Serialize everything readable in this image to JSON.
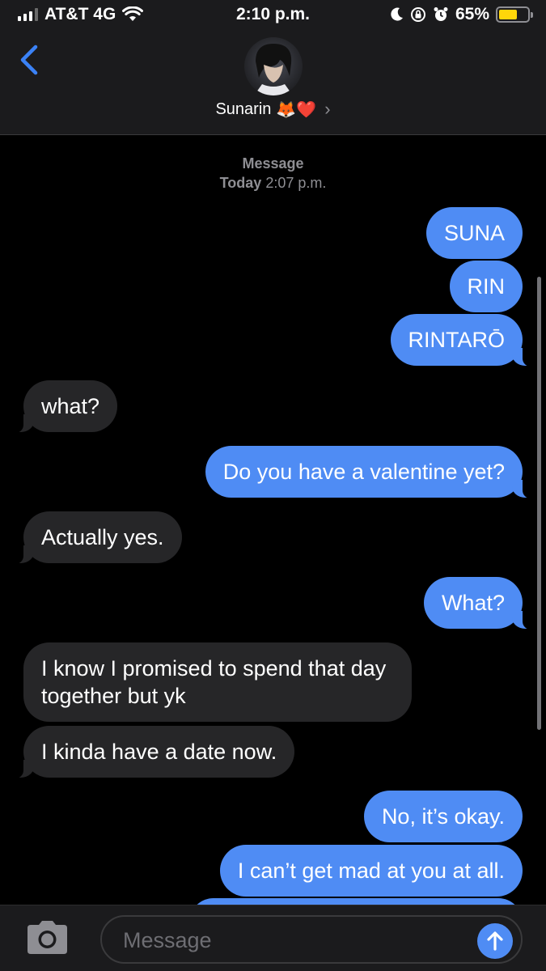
{
  "status_bar": {
    "carrier": "AT&T 4G",
    "time": "2:10 p.m.",
    "battery": "65%",
    "battery_level": 0.65,
    "icons": [
      "signal-icon",
      "wifi-icon",
      "moon-icon",
      "orientation-lock-icon",
      "alarm-icon",
      "battery-icon"
    ]
  },
  "header": {
    "contact_name": "Sunarin",
    "emoji": "🦊❤️",
    "chevron": "›"
  },
  "thread": {
    "service_label": "Message",
    "day_label": "Today",
    "time_label": "2:07 p.m.",
    "messages": [
      {
        "from": "me",
        "text": "SUNA"
      },
      {
        "from": "me",
        "text": "RIN"
      },
      {
        "from": "me",
        "text": "RINTARŌ"
      },
      {
        "from": "them",
        "text": "what?"
      },
      {
        "from": "me",
        "text": "Do you have a valentine yet?"
      },
      {
        "from": "them",
        "text": "Actually yes."
      },
      {
        "from": "me",
        "text": "What?"
      },
      {
        "from": "them",
        "text": "I know I promised to spend that day together but yk"
      },
      {
        "from": "them",
        "text": "I kinda have a date now."
      },
      {
        "from": "me",
        "text": "No, it’s okay."
      },
      {
        "from": "me",
        "text": "I can’t get mad at you at all."
      }
    ]
  },
  "input_bar": {
    "placeholder": "Message"
  },
  "colors": {
    "sent_bubble": "#4f8cf4",
    "received_bubble": "#262628",
    "background": "#000000",
    "battery": "#ffd60a"
  }
}
